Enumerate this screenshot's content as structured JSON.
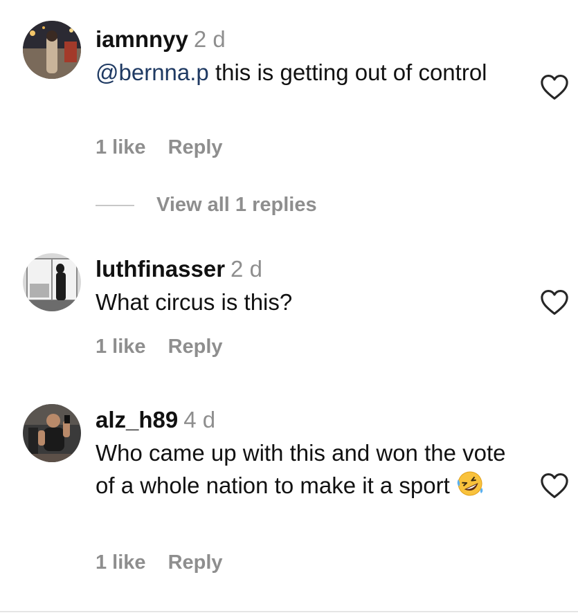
{
  "comments": [
    {
      "username": "iamnnyy",
      "time": "2 d",
      "mention": "@bernna.p",
      "text": " this is getting out of control",
      "likes": "1 like",
      "reply_label": "Reply",
      "avatar_icon": "profile-photo-street-night"
    },
    {
      "username": "luthfinasser",
      "time": "2 d",
      "mention": "",
      "text": "What circus is this?",
      "likes": "1 like",
      "reply_label": "Reply",
      "avatar_icon": "profile-photo-window-silhouette"
    },
    {
      "username": "alz_h89",
      "time": "4 d",
      "mention": "",
      "text": "Who came up with this and won the vote of a whole nation to make it a sport",
      "emoji": "🤣",
      "likes": "1 like",
      "reply_label": "Reply",
      "avatar_icon": "profile-photo-gym-selfie"
    }
  ],
  "view_replies": "View all 1 replies",
  "icons": {
    "like": "heart-outline-icon",
    "emoji": "rolling-on-floor-laughing-emoji"
  },
  "colors": {
    "mention": "#1f3a63",
    "muted": "#8e8e8e",
    "text": "#111111"
  }
}
